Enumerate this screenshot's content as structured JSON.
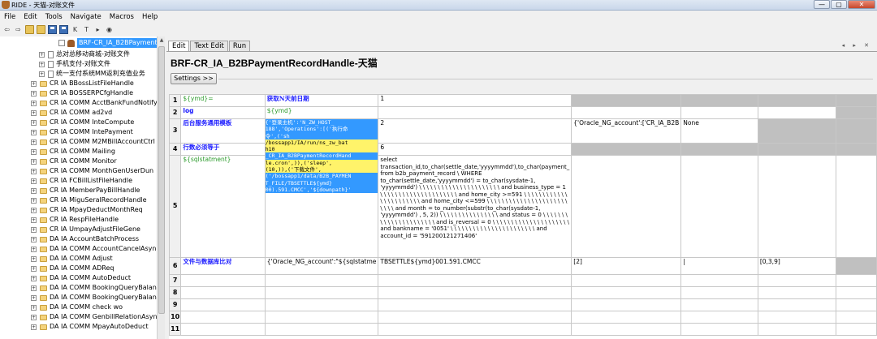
{
  "window": {
    "title": "RIDE - 天猫-对账文件",
    "min": "—",
    "max": "▢",
    "close": "✕"
  },
  "menu": [
    "File",
    "Edit",
    "Tools",
    "Navigate",
    "Macros",
    "Help"
  ],
  "toolbar": {
    "icons": [
      "back-arrow-icon",
      "forward-arrow-icon",
      "open-folder-icon",
      "open-directory-icon",
      "save-icon",
      "save-all-icon",
      "search-keyword-icon",
      "search-test-icon",
      "run-icon",
      "stop-icon"
    ],
    "k_label": "K",
    "t_label": "T"
  },
  "tree": {
    "items": [
      {
        "label": "BRF-CR_IA_B2BPayment",
        "selected": true,
        "type": "test"
      },
      {
        "label": "总对总移动商城-对账文件",
        "type": "file"
      },
      {
        "label": "手机支付-对账文件",
        "type": "file"
      },
      {
        "label": "统一支付系统MM返利充值业务",
        "type": "file"
      },
      {
        "label": "CR IA BBossListFileHandle",
        "type": "folder"
      },
      {
        "label": "CR IA BOSSERPCfgHandle",
        "type": "folder"
      },
      {
        "label": "CR IA COMM AcctBankFundNotify",
        "type": "folder"
      },
      {
        "label": "CR IA COMM ad2vd",
        "type": "folder"
      },
      {
        "label": "CR IA COMM InteCompute",
        "type": "folder"
      },
      {
        "label": "CR IA COMM IntePayment",
        "type": "folder"
      },
      {
        "label": "CR IA COMM M2MBillAccountCtrl",
        "type": "folder"
      },
      {
        "label": "CR IA COMM Mailing",
        "type": "folder"
      },
      {
        "label": "CR IA COMM Monitor",
        "type": "folder"
      },
      {
        "label": "CR IA COMM MonthGenUserDun",
        "type": "folder"
      },
      {
        "label": "CR IA FCBillListFileHandle",
        "type": "folder"
      },
      {
        "label": "CR IA MemberPayBillHandle",
        "type": "folder"
      },
      {
        "label": "CR IA MiguSeralRecordHandle",
        "type": "folder"
      },
      {
        "label": "CR IA MpayDeductMonthReq",
        "type": "folder"
      },
      {
        "label": "CR IA RespFileHandle",
        "type": "folder"
      },
      {
        "label": "CR IA UmpayAdjustFileGene",
        "type": "folder"
      },
      {
        "label": "DA IA AccountBatchProcess",
        "type": "folder"
      },
      {
        "label": "DA IA COMM AccountCancelAsyn",
        "type": "folder"
      },
      {
        "label": "DA IA COMM Adjust",
        "type": "folder"
      },
      {
        "label": "DA IA COMM ADReq",
        "type": "folder"
      },
      {
        "label": "DA IA COMM AutoDeduct",
        "type": "folder"
      },
      {
        "label": "DA IA COMM BookingQueryBalanc",
        "type": "folder"
      },
      {
        "label": "DA IA COMM BookingQueryBalanc",
        "type": "folder"
      },
      {
        "label": "DA IA COMM check wo",
        "type": "folder"
      },
      {
        "label": "DA IA COMM GenbillRelationAsyn",
        "type": "folder"
      },
      {
        "label": "DA IA COMM MpayAutoDeduct",
        "type": "folder"
      }
    ]
  },
  "editor": {
    "tabs": [
      "Edit",
      "Text Edit",
      "Run"
    ],
    "nav_arrows": "◂ ▸ ✕",
    "title": "BRF-CR_IA_B2BPaymentRecordHandle-天猫",
    "settings_label": "Settings >>",
    "rows": [
      {
        "num": "1",
        "c0": "${ymd}=",
        "c1": "获取N天前日期",
        "c2": "1",
        "c3": "",
        "c4": "",
        "c5": "",
        "c6": ""
      },
      {
        "num": "2",
        "c0": "log",
        "c1": "${ymd}",
        "c2": "",
        "c3": "",
        "c4": "",
        "c5": "",
        "c6": ""
      },
      {
        "num": "3",
        "c0": "后台服务通用模板",
        "c1": "",
        "c2": "2",
        "c3": "{'Oracle_NG_account':['CR_IA_B2B",
        "c4": "None",
        "c5": "",
        "c6": ""
      },
      {
        "num": "4",
        "c0": "行数必须等于",
        "c1": "",
        "c2": "6",
        "c3": "",
        "c4": "",
        "c5": "",
        "c6": ""
      },
      {
        "num": "5",
        "c0": "${sqlstatment}",
        "c1": "",
        "c2": "select transaction_id,to_char(settle_date,'yyyymmdd'),to_char(payment_ from b2b_payment_record \\ WHERE to_char(settle_date,'yyyymmdd') = to_char(sysdate-1, 'yyyymmdd') \\ \\ \\ \\ \\ \\ \\ \\ \\ \\ \\ \\ \\ \\ \\ \\ \\ \\ \\ \\ \\ \\ and business_type = 1 \\ \\ \\ \\ \\ \\ \\ \\ \\ \\ \\ \\ \\ \\ \\ \\ \\ \\ \\ \\ \\ and home_city >=591 \\ \\ \\ \\ \\ \\ \\ \\ \\ \\ \\ \\ \\ \\ \\ \\ \\ \\ \\ \\ \\ \\ \\ and home_city <=599 \\ \\ \\ \\ \\ \\ \\ \\ \\ \\ \\ \\ \\ \\ \\ \\ \\ \\ \\ \\ \\ \\ \\ \\ \\ \\ and month = to_number(substr(to_char(sysdate-1, 'yyyymmdd') , 5, 2)) \\ \\ \\ \\ \\ \\ \\ \\ \\ \\ \\ \\ \\ \\ \\ \\ and status = 0 \\ \\ \\ \\ \\ \\ \\ \\ \\ \\ \\ \\ \\ \\ \\ \\ \\ \\ \\ \\ \\ \\ and is_reversal = 0 \\ \\ \\ \\ \\ \\ \\ \\ \\ \\ \\ \\ \\ \\ \\ \\ \\ \\ \\ \\ \\ and bankname = '0051' \\ \\ \\ \\ \\ \\ \\ \\ \\ \\ \\ \\ \\ \\ \\ \\ \\ \\ \\ \\ \\ \\ \\ and account_id = '591200121271406'",
        "c3": "",
        "c4": "",
        "c5": "",
        "c6": ""
      },
      {
        "num": "6",
        "c0": "文件与数据库比对",
        "c1": "{'Oracle_NG_account':\"${sqlstatme",
        "c2": "TBSETTLE${ymd}001.591.CMCC",
        "c3": "[2]",
        "c4": "|",
        "c5": "[0,3,9]",
        "c6": ""
      },
      {
        "num": "7",
        "c0": "",
        "c1": "",
        "c2": "",
        "c3": "",
        "c4": "",
        "c5": "",
        "c6": ""
      },
      {
        "num": "8",
        "c0": "",
        "c1": "",
        "c2": "",
        "c3": "",
        "c4": "",
        "c5": "",
        "c6": ""
      },
      {
        "num": "9",
        "c0": "",
        "c1": "",
        "c2": "",
        "c3": "",
        "c4": "",
        "c5": "",
        "c6": ""
      },
      {
        "num": "10",
        "c0": "",
        "c1": "",
        "c2": "",
        "c3": "",
        "c4": "",
        "c5": "",
        "c6": ""
      },
      {
        "num": "11",
        "c0": "",
        "c1": "",
        "c2": "",
        "c3": "",
        "c4": "",
        "c5": "",
        "c6": ""
      }
    ],
    "popup_code": {
      "lines": [
        {
          "t": "{'登录主机':'N_ZW_HOST_",
          "hl": true
        },
        {
          "t": "188','Operations':[('执行命",
          "hl": true
        },
        {
          "t": "令',('sh",
          "hl": true
        },
        {
          "t": "/bossapp1/IA/run/ns_zw_bat",
          "hl": true
        },
        {
          "t": "h10",
          "hl": true
        },
        {
          "t": "_CR_IA_B2BPaymentRecordHand",
          "hl": false
        },
        {
          "t": "le.cron',)),('sleep',",
          "hl": true
        },
        {
          "t": "(10,)),('下载文件',",
          "hl": true
        },
        {
          "t": "('/bossapp1/data/B2B_PAYMEN",
          "hl": false
        },
        {
          "t": "T_FILE/TBSETTLE${ymd}",
          "hl": false
        },
        {
          "t": "00).591.CMCC','${downpath}'",
          "hl": false
        }
      ]
    }
  }
}
